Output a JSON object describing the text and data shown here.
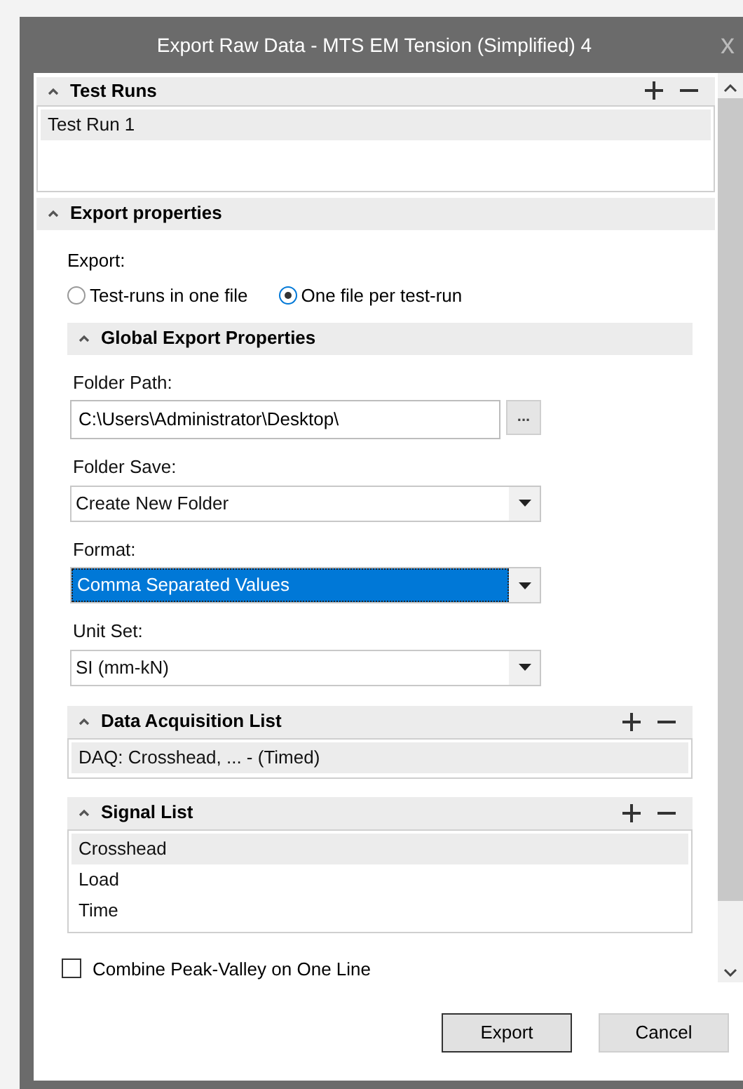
{
  "window": {
    "title": "Export Raw Data - MTS EM Tension (Simplified) 4",
    "close": "x"
  },
  "test_runs": {
    "title": "Test Runs",
    "expanded": true,
    "items": [
      {
        "label": "Test Run 1",
        "selected": true
      }
    ]
  },
  "export_properties": {
    "title": "Export properties",
    "expanded": true,
    "export_label": "Export:",
    "options": [
      {
        "label": "Test-runs in one file",
        "selected": false
      },
      {
        "label": "One file per test-run",
        "selected": true
      }
    ],
    "global": {
      "title": "Global Export Properties",
      "expanded": true,
      "fields": [
        {
          "kind": "browse",
          "label": "Folder Path:",
          "value": "C:\\Users\\Administrator\\Desktop\\",
          "button": "...",
          "focused": false
        },
        {
          "kind": "select",
          "label": "Folder Save:",
          "value": "Create New Folder",
          "focused": false
        },
        {
          "kind": "select",
          "label": "Format:",
          "value": "Comma Separated Values",
          "focused": true
        },
        {
          "kind": "select",
          "label": "Unit Set:",
          "value": "SI (mm-kN)",
          "focused": false
        }
      ]
    },
    "daq": {
      "title": "Data Acquisition List",
      "expanded": true,
      "items": [
        {
          "label": "DAQ: Crosshead, ... - (Timed)",
          "selected": true
        }
      ]
    },
    "signals": {
      "title": "Signal List",
      "expanded": true,
      "items": [
        {
          "label": "Crosshead",
          "selected": true
        },
        {
          "label": "Load",
          "selected": false
        },
        {
          "label": "Time",
          "selected": false
        }
      ]
    },
    "combine": {
      "label": "Combine Peak-Valley on One Line",
      "checked": false
    }
  },
  "buttons": [
    {
      "label": "Export",
      "default": true
    },
    {
      "label": "Cancel",
      "default": false
    }
  ]
}
